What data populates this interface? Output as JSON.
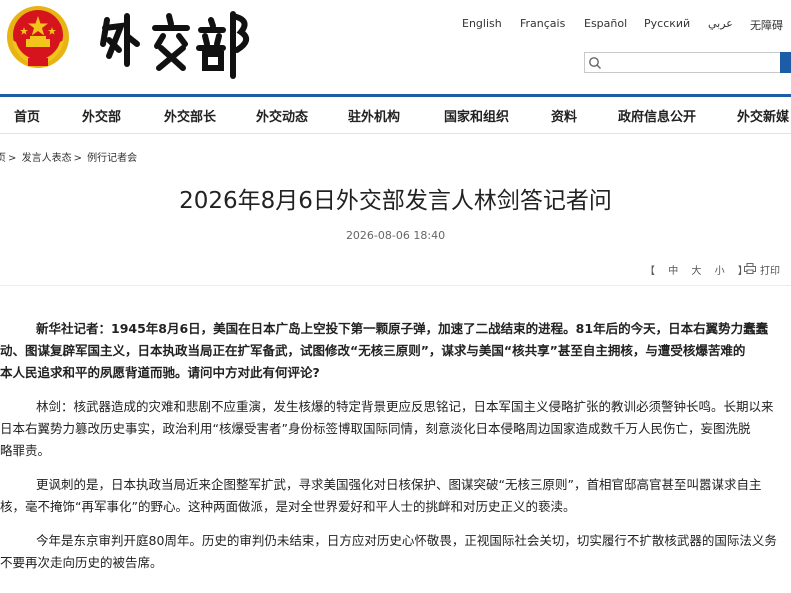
{
  "header": {
    "logo_text": "外交部",
    "languages": [
      "English",
      "Français",
      "Español",
      "Русский",
      "عربي",
      "无障碍"
    ],
    "search": {
      "placeholder": "",
      "value": ""
    }
  },
  "nav": {
    "items": [
      "首页",
      "外交部",
      "外交部长",
      "外交动态",
      "驻外机构",
      "国家和组织",
      "资料",
      "政府信息公开",
      "外交新媒"
    ]
  },
  "breadcrumb": [
    "页",
    "发言人表态",
    "例行记者会"
  ],
  "article": {
    "title": "2026年8月6日外交部发言人林剑答记者问",
    "date": "2026-08-06 18:40",
    "font_label": "【 中 大 小 】",
    "font_sizes": [
      "【",
      "中",
      "大",
      "小",
      "】"
    ],
    "print_label": "打印",
    "paragraphs": [
      {
        "type": "question",
        "lines": [
          "新华社记者：1945年8月6日，美国在日本广岛上空投下第一颗原子弹，加速了二战结束的进程。81年后的今天，日本右翼势力蠢蠢",
          "动、图谋复辟军国主义，日本执政当局正在扩军备武，试图修改“无核三原则”，谋求与美国“核共享”甚至自主拥核，与遭受核爆苦难的",
          "本人民追求和平的夙愿背道而驰。请问中方对此有何评论?"
        ]
      },
      {
        "type": "answer",
        "lines": [
          "林剑：核武器造成的灾难和悲剧不应重演，发生核爆的特定背景更应反思铭记，日本军国主义侵略扩张的教训必须警钟长鸣。长期以来",
          "日本右翼势力篡改历史事实，政治利用“核爆受害者”身份标签博取国际同情，刻意淡化日本侵略周边国家造成数千万人民伤亡，妄图洗脱",
          "略罪责。"
        ]
      },
      {
        "type": "answer",
        "lines": [
          "更讽刺的是，日本执政当局近来企图整军扩武，寻求美国强化对日核保护、图谋突破“无核三原则”，首相官邸高官甚至叫嚣谋求自主",
          "核，毫不掩饰“再军事化”的野心。这种两面做派，是对全世界爱好和平人士的挑衅和对历史正义的亵渎。"
        ]
      },
      {
        "type": "answer",
        "lines": [
          "今年是东京审判开庭80周年。历史的审判仍未结束，日方应对历史心怀敬畏，正视国际社会关切，切实履行不扩散核武器的国际法义务",
          "不要再次走向历史的被告席。"
        ]
      }
    ]
  },
  "colors": {
    "accent": "#1d5da8",
    "emblem_red": "#d6141e",
    "emblem_gold": "#f3c41b"
  }
}
